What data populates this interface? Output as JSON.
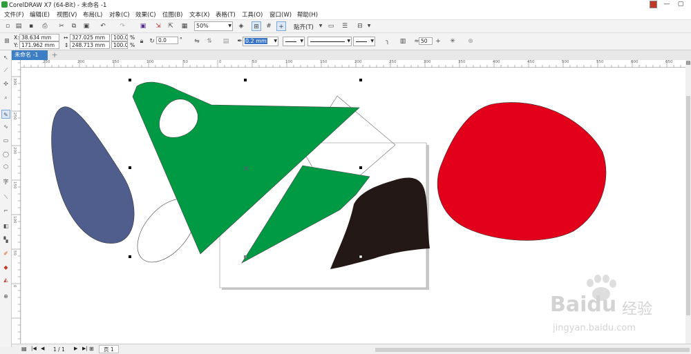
{
  "window": {
    "title": "CorelDRAW X7 (64-Bit) - 未命名 -1",
    "minimize": "—",
    "maximize": "▢"
  },
  "menu": [
    {
      "label": "文件(F)",
      "name": "file"
    },
    {
      "label": "编辑(E)",
      "name": "edit"
    },
    {
      "label": "视图(V)",
      "name": "view"
    },
    {
      "label": "布局(L)",
      "name": "layout"
    },
    {
      "label": "对象(C)",
      "name": "object"
    },
    {
      "label": "效果(C)",
      "name": "effects"
    },
    {
      "label": "位图(B)",
      "name": "bitmaps"
    },
    {
      "label": "文本(X)",
      "name": "text"
    },
    {
      "label": "表格(T)",
      "name": "table"
    },
    {
      "label": "工具(O)",
      "name": "tools"
    },
    {
      "label": "窗口(W)",
      "name": "window"
    },
    {
      "label": "帮助(H)",
      "name": "help"
    }
  ],
  "toolbar": {
    "zoom": "50%",
    "snap_label": "贴齐(T)"
  },
  "property_bar": {
    "x_label": "X:",
    "x_value": "38.634 mm",
    "y_label": "Y:",
    "y_value": "171.962 mm",
    "width": "327.025 mm",
    "height": "248.713 mm",
    "scale_x": "100.0",
    "scale_y": "100.0",
    "percent": "%",
    "rotation": "0.0",
    "degree": "°",
    "outline_width": "0.2 mm",
    "smoothing": "50"
  },
  "document_tab": {
    "label": "未命名 -1",
    "add": "+"
  },
  "rulers": {
    "horizontal": [
      "250",
      "200",
      "150",
      "100",
      "50",
      "0",
      "50",
      "100",
      "150",
      "200",
      "250",
      "300",
      "350",
      "400",
      "450",
      "500",
      "550",
      "600",
      "650"
    ],
    "vertical": [
      "300",
      "250",
      "200",
      "150",
      "100",
      "50",
      "0"
    ]
  },
  "statusbar": {
    "page_count": "1 / 1",
    "page_tab": "页 1"
  },
  "watermark": {
    "brand": "Baidu",
    "suffix": "经验",
    "url": "jingyan.baidu.com"
  },
  "colors": {
    "green": "#009a44",
    "blue": "#4f5e8c",
    "red": "#e2001a",
    "black": "#231815",
    "tab_active": "#3d7fc4"
  }
}
